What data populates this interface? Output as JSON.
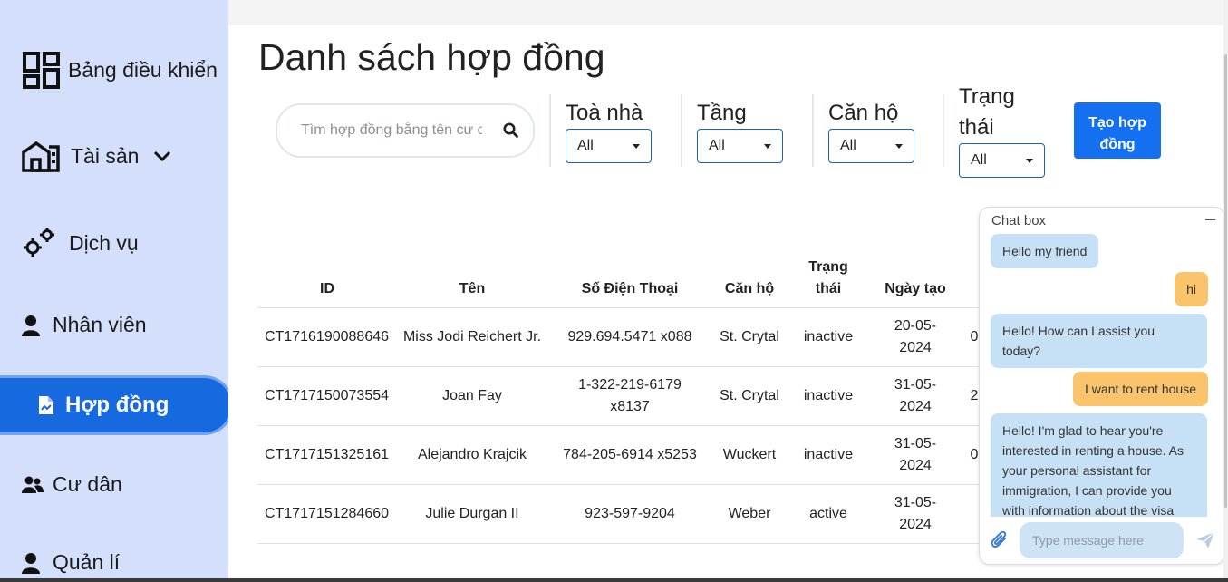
{
  "sidebar": {
    "items": [
      {
        "label": "Bảng điều khiển",
        "icon": "dashboard-icon"
      },
      {
        "label": "Tài sản",
        "icon": "building-icon"
      },
      {
        "label": "Dịch vụ",
        "icon": "gears-icon"
      },
      {
        "label": "Nhân viên",
        "icon": "employee-icon"
      },
      {
        "label": "Hợp đồng",
        "icon": "contract-icon",
        "active": true
      },
      {
        "label": "Cư dân",
        "icon": "residents-icon"
      },
      {
        "label": "Quản lí",
        "icon": "manager-icon"
      }
    ]
  },
  "main": {
    "title": "Danh sách hợp đồng",
    "search": {
      "placeholder": "Tìm hợp đồng bằng tên cư dân",
      "value": ""
    },
    "filters": {
      "building": {
        "label": "Toà nhà",
        "value": "All"
      },
      "floor": {
        "label": "Tầng",
        "value": "All"
      },
      "apartment": {
        "label": "Căn hộ",
        "value": "All"
      },
      "status": {
        "label": "Trạng thái",
        "value": "All"
      }
    },
    "create_button": "Tạo hợp đồng"
  },
  "table": {
    "headers": {
      "id": "ID",
      "name": "Tên",
      "phone": "Số Điện Thoại",
      "apartment": "Căn hộ",
      "status": "Trạng thái",
      "created": "Ngày tạo"
    },
    "rows": [
      {
        "id": "CT1716190088646",
        "name": "Miss Jodi Reichert Jr.",
        "phone": "929.694.5471 x088",
        "apartment": "St. Crytal",
        "status": "inactive",
        "created": "20-05-2024",
        "extra": "0"
      },
      {
        "id": "CT1717150073554",
        "name": "Joan Fay",
        "phone": "1-322-219-6179 x8137",
        "apartment": "St. Crytal",
        "status": "inactive",
        "created": "31-05-2024",
        "extra": "2"
      },
      {
        "id": "CT1717151325161",
        "name": "Alejandro Krajcik",
        "phone": "784-205-6914 x5253",
        "apartment": "Wuckert",
        "status": "inactive",
        "created": "31-05-2024",
        "extra": "0"
      },
      {
        "id": "CT1717151284660",
        "name": "Julie Durgan II",
        "phone": "923-597-9204",
        "apartment": "Weber",
        "status": "active",
        "created": "31-05-2024",
        "extra": ""
      }
    ]
  },
  "chat": {
    "title": "Chat box",
    "messages": [
      {
        "from": "bot",
        "text": "Hello my friend"
      },
      {
        "from": "user",
        "text": "hi"
      },
      {
        "from": "bot",
        "text": "Hello! How can I assist you today?"
      },
      {
        "from": "user",
        "text": "I want to rent house"
      },
      {
        "from": "bot",
        "text": "Hello! I'm glad to hear you're interested in renting a house. As your personal assistant for immigration, I can provide you with information about the visa"
      }
    ],
    "input_placeholder": "Type message here"
  },
  "colors": {
    "sidebar_bg": "#d4e0fb",
    "accent": "#1769e0",
    "button": "#1470f0",
    "bot_bubble": "#c6e0f6",
    "user_bubble": "#f9c46b"
  }
}
